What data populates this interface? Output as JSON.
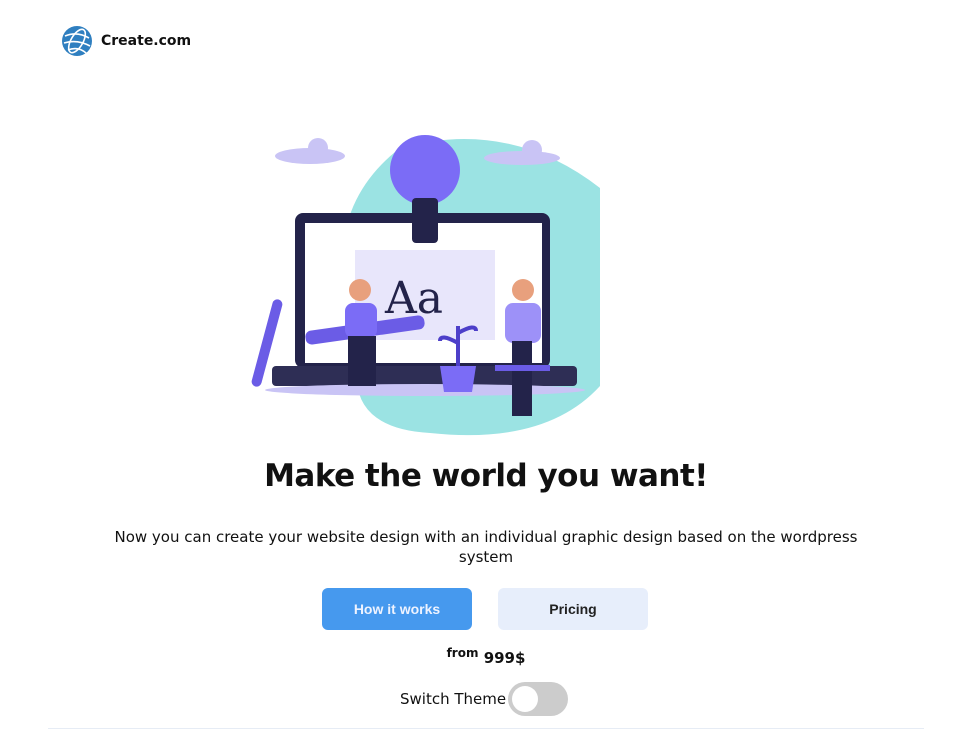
{
  "header": {
    "brand": "Create.com",
    "logo_icon": "globe-icon"
  },
  "hero": {
    "illustration": "web-designers-laptop-lightbulb-illustration"
  },
  "main": {
    "title": "Make the world you want!",
    "description": "Now you can create your website design with an individual graphic design based on the wordpress system",
    "how_label": "How it works",
    "pricing_label": "Pricing",
    "price_prefix": "from",
    "price_value": "999$",
    "theme_label": "Switch Theme",
    "theme_on": false
  },
  "colors": {
    "primary": "#4699ee",
    "secondary": "#e7eefb",
    "blob": "#9be3e3",
    "accent": "#7b6cf6"
  }
}
